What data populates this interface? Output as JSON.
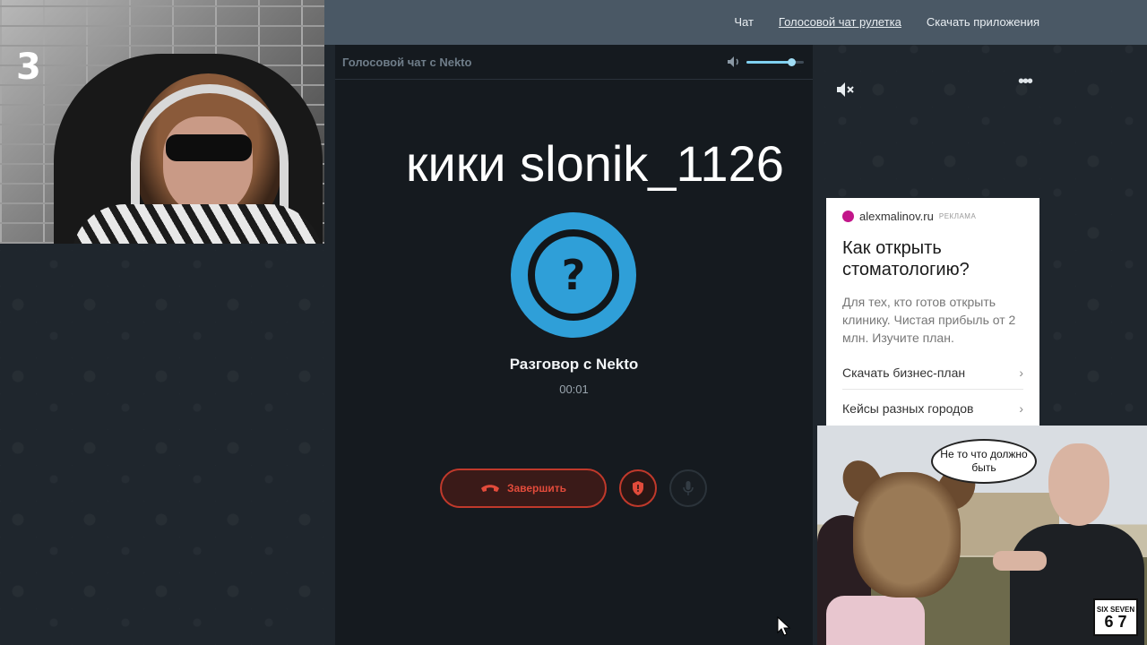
{
  "nav": {
    "items": [
      {
        "label": "Чат"
      },
      {
        "label": "Голосовой чат рулетка",
        "active": true
      },
      {
        "label": "Скачать приложения"
      }
    ]
  },
  "panel": {
    "title": "Голосовой чат с Nekto",
    "volume_level": 0.78,
    "conversation_title": "Разговор с Nekto",
    "timer": "00:01",
    "end_label": "Завершить",
    "avatar_symbol": "?"
  },
  "overlay": {
    "text": "кики slonik_1126"
  },
  "webcam": {
    "mark": "3"
  },
  "ad": {
    "domain": "alexmalinov.ru",
    "tag": "РЕКЛАМА",
    "headline": "Как открыть стоматологию?",
    "body": "Для тех, кто готов открыть клинику. Чистая прибыль от 2 млн. Изучите план.",
    "links": [
      "Скачать бизнес-план",
      "Кейсы разных городов"
    ],
    "chevron": "›"
  },
  "meme": {
    "bubble": "Не то что должно быть",
    "badge_top": "SIX SEVEN",
    "badge_num": "6 7"
  },
  "colors": {
    "accent_blue": "#2f9fd8",
    "danger_red": "#c0392b",
    "topbar": "#4a5865"
  }
}
